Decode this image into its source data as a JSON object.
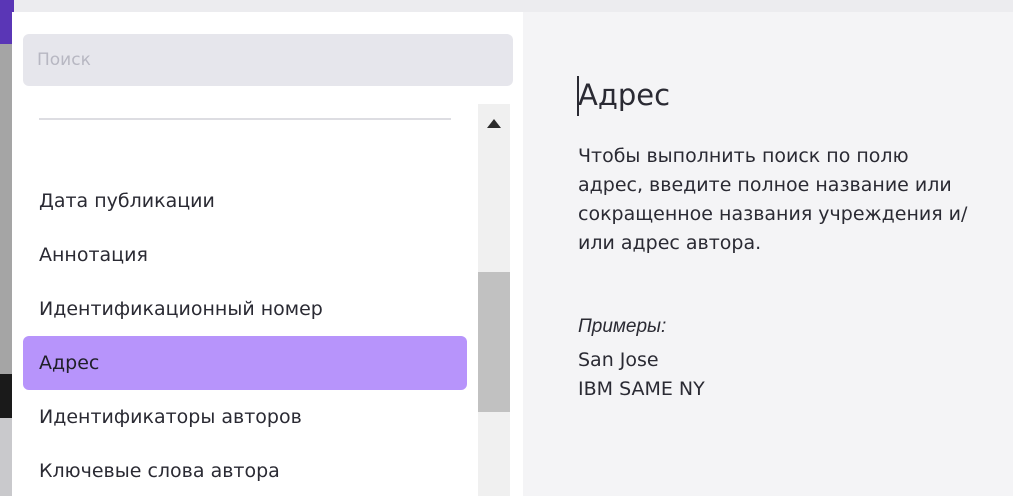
{
  "search": {
    "placeholder": "Поиск",
    "value": ""
  },
  "fields": {
    "items": [
      {
        "label": "Дата публикации"
      },
      {
        "label": "Аннотация"
      },
      {
        "label": "Идентификационный номер"
      },
      {
        "label": "Адрес",
        "selected": true
      },
      {
        "label": "Идентификаторы авторов"
      },
      {
        "label": "Ключевые слова автора"
      }
    ]
  },
  "help": {
    "title": "Адрес",
    "description": "Чтобы выполнить поиск по полю адрес, введите полное название или сокращенное названия учреждения и/или адрес автора.",
    "examples_label": "Примеры:",
    "examples": [
      "San Jose",
      "IBM SAME NY"
    ]
  },
  "colors": {
    "selected_item": "#b794fb",
    "search_bg": "#e6e6ec",
    "help_bg": "#f4f4f6",
    "accent": "#5a36b6"
  },
  "icons": {
    "scroll_up": "triangle-up-icon"
  }
}
